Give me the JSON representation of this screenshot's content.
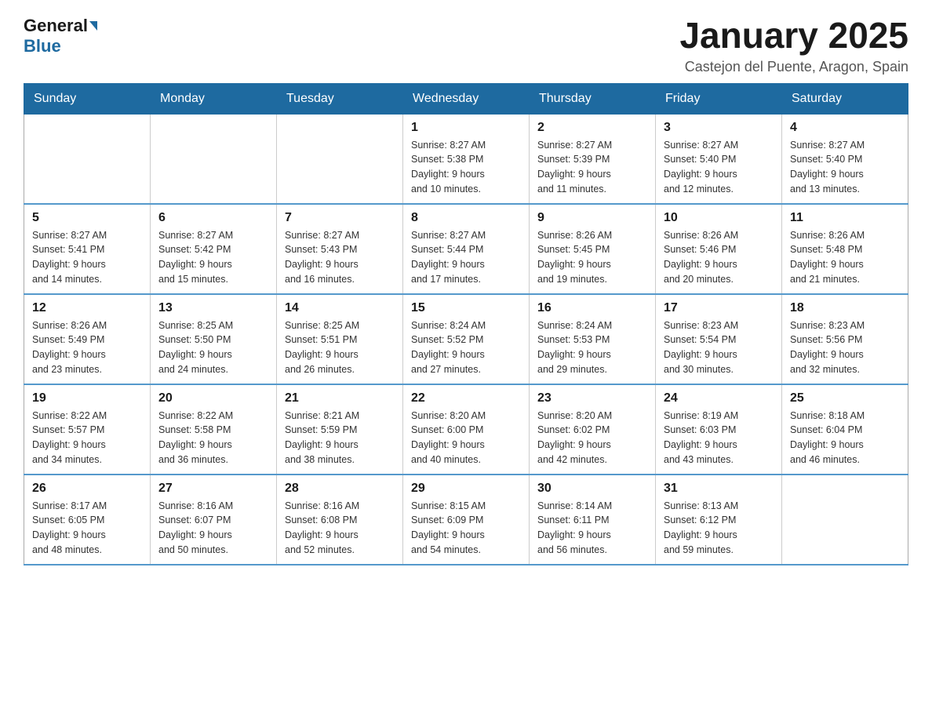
{
  "header": {
    "logo_general": "General",
    "logo_blue": "Blue",
    "title": "January 2025",
    "subtitle": "Castejon del Puente, Aragon, Spain"
  },
  "weekdays": [
    "Sunday",
    "Monday",
    "Tuesday",
    "Wednesday",
    "Thursday",
    "Friday",
    "Saturday"
  ],
  "weeks": [
    [
      {
        "date": "",
        "info": ""
      },
      {
        "date": "",
        "info": ""
      },
      {
        "date": "",
        "info": ""
      },
      {
        "date": "1",
        "info": "Sunrise: 8:27 AM\nSunset: 5:38 PM\nDaylight: 9 hours\nand 10 minutes."
      },
      {
        "date": "2",
        "info": "Sunrise: 8:27 AM\nSunset: 5:39 PM\nDaylight: 9 hours\nand 11 minutes."
      },
      {
        "date": "3",
        "info": "Sunrise: 8:27 AM\nSunset: 5:40 PM\nDaylight: 9 hours\nand 12 minutes."
      },
      {
        "date": "4",
        "info": "Sunrise: 8:27 AM\nSunset: 5:40 PM\nDaylight: 9 hours\nand 13 minutes."
      }
    ],
    [
      {
        "date": "5",
        "info": "Sunrise: 8:27 AM\nSunset: 5:41 PM\nDaylight: 9 hours\nand 14 minutes."
      },
      {
        "date": "6",
        "info": "Sunrise: 8:27 AM\nSunset: 5:42 PM\nDaylight: 9 hours\nand 15 minutes."
      },
      {
        "date": "7",
        "info": "Sunrise: 8:27 AM\nSunset: 5:43 PM\nDaylight: 9 hours\nand 16 minutes."
      },
      {
        "date": "8",
        "info": "Sunrise: 8:27 AM\nSunset: 5:44 PM\nDaylight: 9 hours\nand 17 minutes."
      },
      {
        "date": "9",
        "info": "Sunrise: 8:26 AM\nSunset: 5:45 PM\nDaylight: 9 hours\nand 19 minutes."
      },
      {
        "date": "10",
        "info": "Sunrise: 8:26 AM\nSunset: 5:46 PM\nDaylight: 9 hours\nand 20 minutes."
      },
      {
        "date": "11",
        "info": "Sunrise: 8:26 AM\nSunset: 5:48 PM\nDaylight: 9 hours\nand 21 minutes."
      }
    ],
    [
      {
        "date": "12",
        "info": "Sunrise: 8:26 AM\nSunset: 5:49 PM\nDaylight: 9 hours\nand 23 minutes."
      },
      {
        "date": "13",
        "info": "Sunrise: 8:25 AM\nSunset: 5:50 PM\nDaylight: 9 hours\nand 24 minutes."
      },
      {
        "date": "14",
        "info": "Sunrise: 8:25 AM\nSunset: 5:51 PM\nDaylight: 9 hours\nand 26 minutes."
      },
      {
        "date": "15",
        "info": "Sunrise: 8:24 AM\nSunset: 5:52 PM\nDaylight: 9 hours\nand 27 minutes."
      },
      {
        "date": "16",
        "info": "Sunrise: 8:24 AM\nSunset: 5:53 PM\nDaylight: 9 hours\nand 29 minutes."
      },
      {
        "date": "17",
        "info": "Sunrise: 8:23 AM\nSunset: 5:54 PM\nDaylight: 9 hours\nand 30 minutes."
      },
      {
        "date": "18",
        "info": "Sunrise: 8:23 AM\nSunset: 5:56 PM\nDaylight: 9 hours\nand 32 minutes."
      }
    ],
    [
      {
        "date": "19",
        "info": "Sunrise: 8:22 AM\nSunset: 5:57 PM\nDaylight: 9 hours\nand 34 minutes."
      },
      {
        "date": "20",
        "info": "Sunrise: 8:22 AM\nSunset: 5:58 PM\nDaylight: 9 hours\nand 36 minutes."
      },
      {
        "date": "21",
        "info": "Sunrise: 8:21 AM\nSunset: 5:59 PM\nDaylight: 9 hours\nand 38 minutes."
      },
      {
        "date": "22",
        "info": "Sunrise: 8:20 AM\nSunset: 6:00 PM\nDaylight: 9 hours\nand 40 minutes."
      },
      {
        "date": "23",
        "info": "Sunrise: 8:20 AM\nSunset: 6:02 PM\nDaylight: 9 hours\nand 42 minutes."
      },
      {
        "date": "24",
        "info": "Sunrise: 8:19 AM\nSunset: 6:03 PM\nDaylight: 9 hours\nand 43 minutes."
      },
      {
        "date": "25",
        "info": "Sunrise: 8:18 AM\nSunset: 6:04 PM\nDaylight: 9 hours\nand 46 minutes."
      }
    ],
    [
      {
        "date": "26",
        "info": "Sunrise: 8:17 AM\nSunset: 6:05 PM\nDaylight: 9 hours\nand 48 minutes."
      },
      {
        "date": "27",
        "info": "Sunrise: 8:16 AM\nSunset: 6:07 PM\nDaylight: 9 hours\nand 50 minutes."
      },
      {
        "date": "28",
        "info": "Sunrise: 8:16 AM\nSunset: 6:08 PM\nDaylight: 9 hours\nand 52 minutes."
      },
      {
        "date": "29",
        "info": "Sunrise: 8:15 AM\nSunset: 6:09 PM\nDaylight: 9 hours\nand 54 minutes."
      },
      {
        "date": "30",
        "info": "Sunrise: 8:14 AM\nSunset: 6:11 PM\nDaylight: 9 hours\nand 56 minutes."
      },
      {
        "date": "31",
        "info": "Sunrise: 8:13 AM\nSunset: 6:12 PM\nDaylight: 9 hours\nand 59 minutes."
      },
      {
        "date": "",
        "info": ""
      }
    ]
  ]
}
